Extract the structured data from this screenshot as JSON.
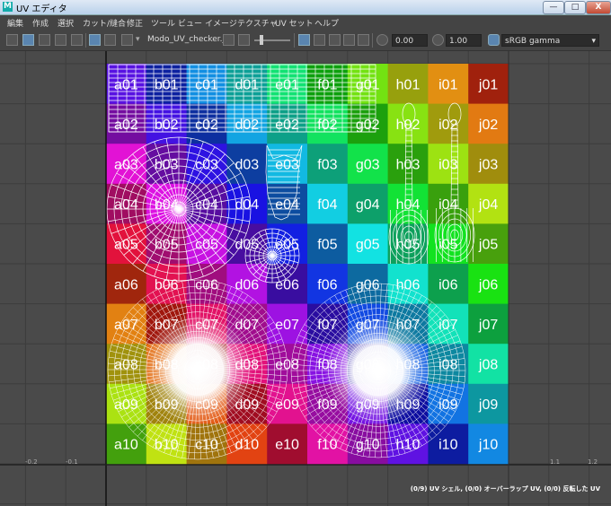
{
  "window": {
    "title": "UV エディタ",
    "icon": "maya-icon",
    "min_label": "—",
    "max_label": "□",
    "close_label": "X"
  },
  "menu": [
    "編集",
    "作成",
    "選択",
    "カット/縫合",
    "修正",
    "ツール",
    "ビュー",
    "イメージ",
    "テクスチャ",
    "UV セット",
    "ヘルプ"
  ],
  "toolbar": {
    "texture_name": "Modo_UV_checker.j",
    "exposure_value": "0.00",
    "gamma_value": "1.00",
    "color_space": "sRGB gamma"
  },
  "checker": {
    "columns": [
      "a",
      "b",
      "c",
      "d",
      "e",
      "f",
      "g",
      "h",
      "i",
      "j"
    ],
    "rows": [
      "01",
      "02",
      "03",
      "04",
      "05",
      "06",
      "07",
      "08",
      "09",
      "10"
    ]
  },
  "ruler": {
    "bottom": [
      "-0.2",
      "-0.1",
      "1.1",
      "1.2"
    ]
  },
  "status_text": "(0/9) UV シェル, (0/0) オーバーラップ UV, (0/0) 反転した UV",
  "colors": {
    "viewport_bg": "#4a4a4a",
    "grid_line": "#3a3a3a",
    "uv_wire": "#ffffff",
    "accent": "#5a85b0"
  }
}
